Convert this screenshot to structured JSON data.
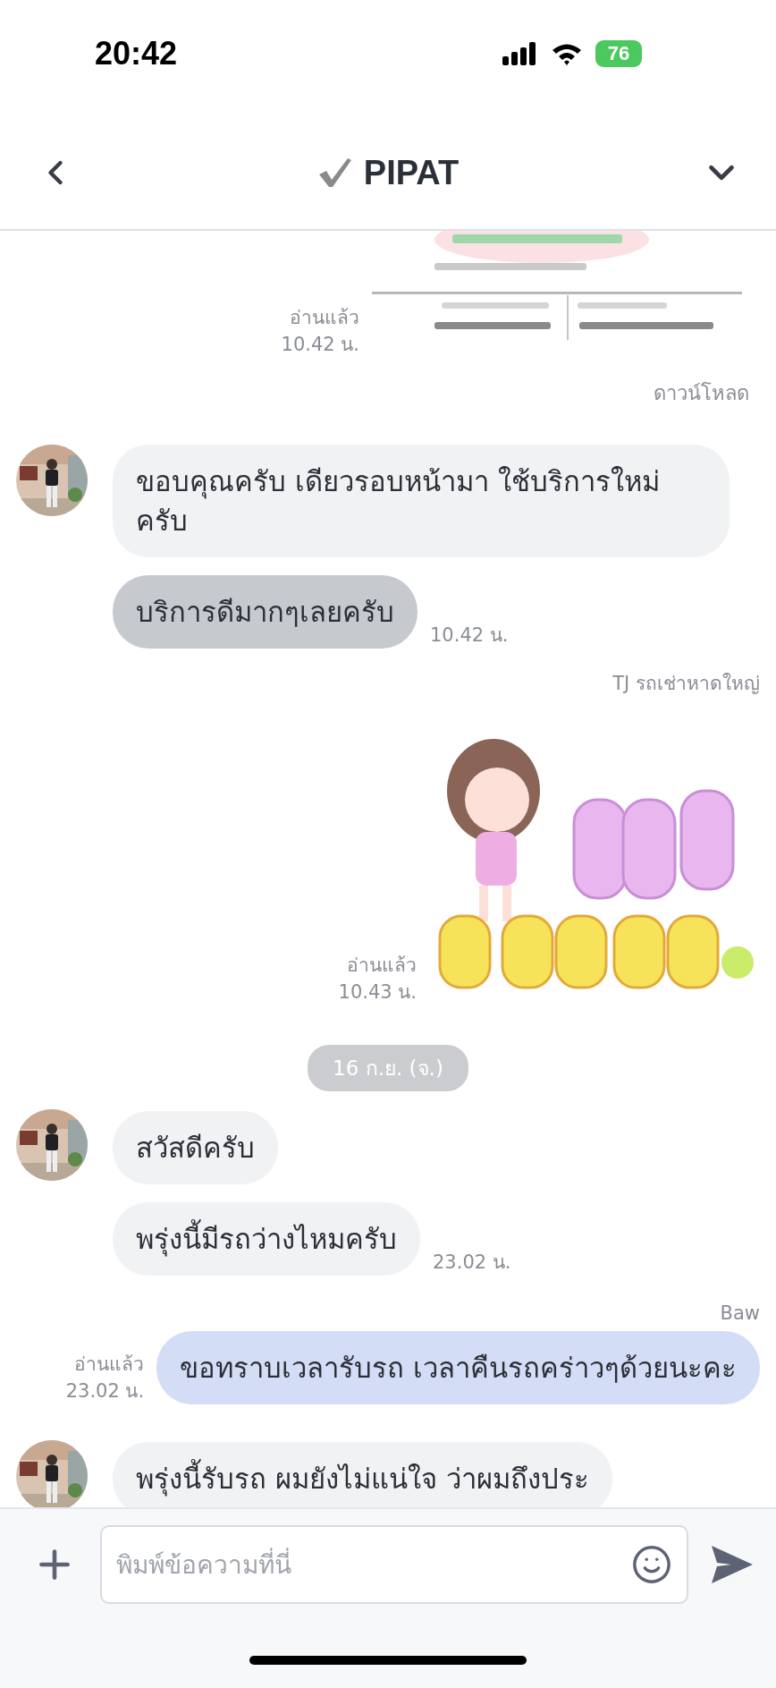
{
  "status_bar": {
    "time": "20:42",
    "battery": "76"
  },
  "header": {
    "title": "PIPAT",
    "verified": true
  },
  "messages": [
    {
      "outgoing": true,
      "read": "อ่านแล้ว",
      "time": "10.42 น.",
      "action": "ดาวน์โหลด"
    },
    {
      "kind": "text",
      "outgoing": false,
      "avatar": true,
      "text": "ขอบคุณครับ เดียวรอบหน้ามา ใช้บริการใหม่ครับ",
      "highlighted": false
    },
    {
      "kind": "text",
      "outgoing": false,
      "avatar": false,
      "text": "บริการดีมากๆเลยครับ",
      "highlighted": true,
      "time": "10.42 น."
    },
    {
      "kind": "sticker",
      "outgoing": true,
      "sender": "TJ รถเช่าหาดใหญ่",
      "read": "อ่านแล้ว",
      "time": "10.43 น."
    },
    {
      "kind": "date",
      "text": "16 ก.ย. (จ.)"
    },
    {
      "kind": "text",
      "outgoing": false,
      "avatar": true,
      "text": "สวัสดีครับ",
      "highlighted": false
    },
    {
      "kind": "text",
      "outgoing": false,
      "avatar": false,
      "text": "พรุ่งนี้มีรถว่างไหมครับ",
      "highlighted": false,
      "time": "23.02 น."
    },
    {
      "kind": "text",
      "outgoing": true,
      "sender": "Baw",
      "text": "ขอทราบเวลารับรถ เวลาคืนรถคร่าวๆด้วยนะคะ",
      "read": "อ่านแล้ว",
      "time": "23.02 น."
    },
    {
      "kind": "text",
      "outgoing": false,
      "avatar": true,
      "text": "พรุ่งนี้รับรถ ผมยังไม่แน่ใจ ว่าผมถึงประ",
      "highlighted": false
    }
  ],
  "composer": {
    "placeholder": "พิมพ์ข้อความที่นี่"
  }
}
